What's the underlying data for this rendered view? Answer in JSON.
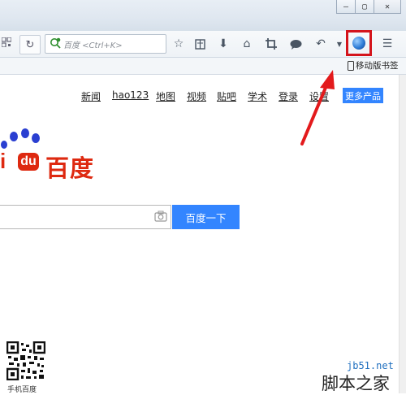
{
  "window": {
    "minimize_glyph": "—",
    "maximize_glyph": "▢",
    "close_glyph": "✕"
  },
  "toolbar": {
    "search_placeholder": "百度 <Ctrl+K>",
    "icons": [
      "qr-code-icon",
      "reload-icon",
      "bookmark-star-icon",
      "reading-list-icon",
      "download-icon",
      "home-icon",
      "crop-icon",
      "chat-icon",
      "back-icon",
      "dropdown-icon",
      "extension-icon",
      "menu-icon"
    ]
  },
  "bookmarks_bar": {
    "mobile_bookmarks": "移动版书签"
  },
  "page": {
    "nav": [
      "新闻",
      "hao123",
      "地图",
      "视频",
      "贴吧",
      "学术",
      "登录",
      "设置"
    ],
    "more_products": "更多产品",
    "logo_du": "du",
    "logo_cn": "百度",
    "search_button": "百度一下",
    "qr_label": "手机百度"
  },
  "watermark": {
    "url": "jb51.net",
    "text": "脚本之家"
  },
  "colors": {
    "accent": "#3385ff",
    "logo_red": "#de2910",
    "highlight_red": "#d4141b",
    "arrow_red": "#e31a1c"
  }
}
